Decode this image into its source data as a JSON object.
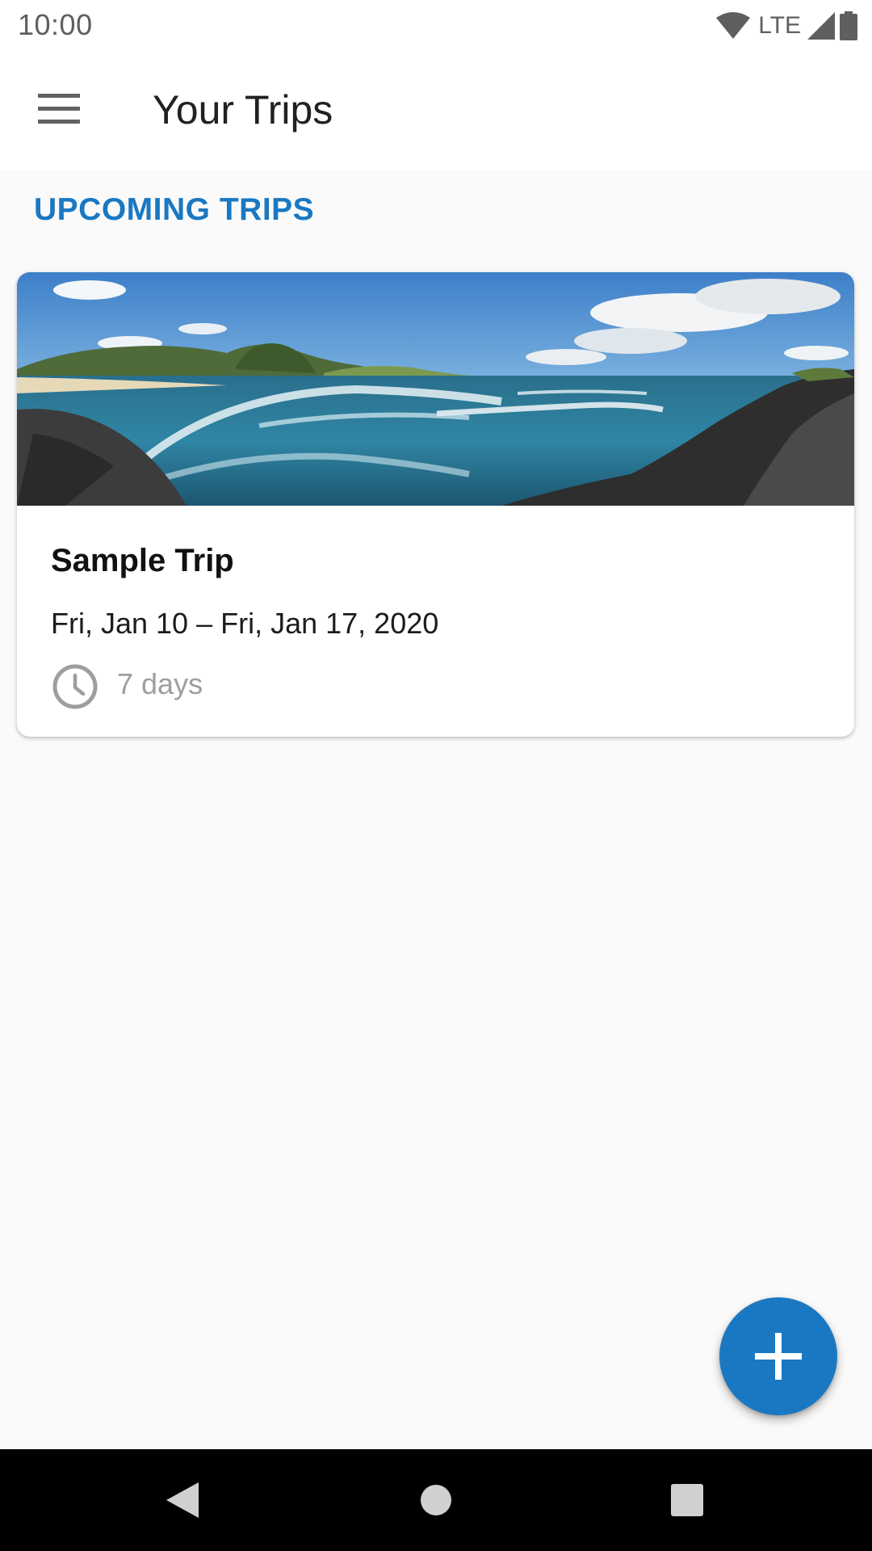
{
  "status_bar": {
    "time": "10:00",
    "network": "LTE",
    "icons": [
      "wifi-icon",
      "cell-signal-icon",
      "battery-icon"
    ]
  },
  "app_bar": {
    "title": "Your Trips",
    "menu_icon": "hamburger-menu-icon"
  },
  "section": {
    "title": "UPCOMING TRIPS"
  },
  "trips": [
    {
      "name": "Sample Trip",
      "dates": "Fri, Jan 10 – Fri, Jan 17, 2020",
      "duration": "7 days",
      "image": "coastal-beach-panorama",
      "duration_icon": "clock-icon"
    }
  ],
  "fab": {
    "icon": "plus-icon"
  },
  "navigation_bar": {
    "buttons": [
      "back-icon",
      "home-icon",
      "recents-icon"
    ]
  },
  "colors": {
    "accent": "#1a78c2",
    "background": "#fafafa",
    "surface": "#ffffff",
    "nav_bar": "#000000",
    "secondary_text": "#9e9e9e"
  }
}
